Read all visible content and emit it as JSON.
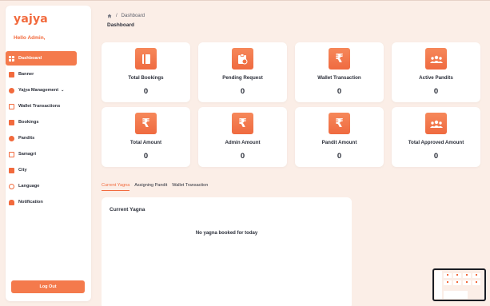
{
  "app": {
    "brand": "yajya",
    "greeting": "Hello Admin,"
  },
  "sidebar": {
    "items": [
      {
        "label": "Dashboard",
        "icon": "grid-icon",
        "active": true
      },
      {
        "label": "Banner",
        "icon": "image-icon"
      },
      {
        "label": "Yajya Management",
        "icon": "fire-icon",
        "has_submenu": true
      },
      {
        "label": "Wallet Transactions",
        "icon": "wallet-icon"
      },
      {
        "label": "Bookings",
        "icon": "calendar-icon"
      },
      {
        "label": "Pandits",
        "icon": "users-icon"
      },
      {
        "label": "Samagri",
        "icon": "cart-icon"
      },
      {
        "label": "City",
        "icon": "city-icon"
      },
      {
        "label": "Language",
        "icon": "globe-icon"
      },
      {
        "label": "Notification",
        "icon": "bell-icon"
      }
    ],
    "logout_label": "Log Out"
  },
  "breadcrumb": {
    "current": "Dashboard"
  },
  "page_title": "Dashboard",
  "cards": [
    {
      "label": "Total Bookings",
      "value": "0",
      "icon": "booking-icon"
    },
    {
      "label": "Pending Request",
      "value": "0",
      "icon": "clipboard-clock-icon"
    },
    {
      "label": "Wallet Transaction",
      "value": "0",
      "icon": "rupee-icon"
    },
    {
      "label": "Active Pandits",
      "value": "0",
      "icon": "group-icon"
    },
    {
      "label": "Total Amount",
      "value": "0",
      "icon": "rupee-icon"
    },
    {
      "label": "Admin Amount",
      "value": "0",
      "icon": "rupee-icon"
    },
    {
      "label": "Pandit Amount",
      "value": "0",
      "icon": "rupee-icon"
    },
    {
      "label": "Total Approved Amount",
      "value": "0",
      "icon": "group-icon"
    }
  ],
  "rupee_symbol": "₹",
  "tabs": [
    {
      "label": "Current Yagna",
      "active": true
    },
    {
      "label": "Assigning Pandit"
    },
    {
      "label": "Wallet Transaction"
    }
  ],
  "panel": {
    "title": "Current Yagna",
    "empty_message": "No yagna booked for today"
  },
  "colors": {
    "accent": "#f26a3d",
    "background": "#fbeee7"
  }
}
